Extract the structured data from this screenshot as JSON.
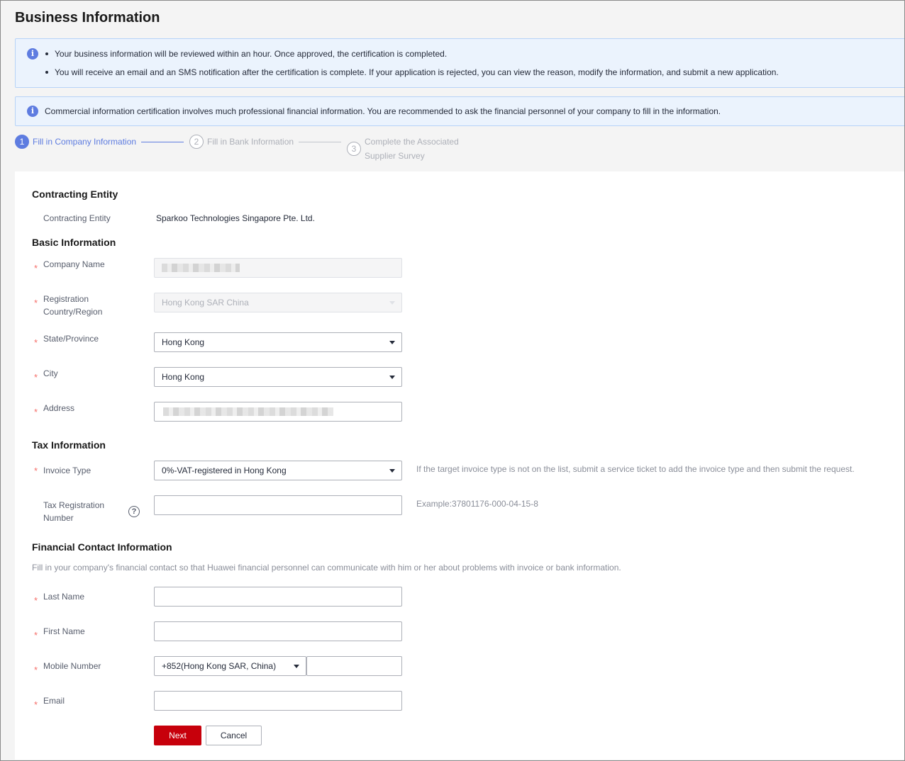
{
  "page": {
    "title": "Business Information"
  },
  "notices": {
    "review": [
      "Your business information will be reviewed within an hour. Once approved, the certification is completed.",
      "You will receive an email and an SMS notification after the certification is complete. If your application is rejected, you can view the reason, modify the information, and submit a new application."
    ],
    "finance": "Commercial information certification involves much professional financial information. You are recommended to ask the financial personnel of your company to fill in the information."
  },
  "steps": [
    {
      "number": "1",
      "label": "Fill in Company Information"
    },
    {
      "number": "2",
      "label": "Fill in Bank Information"
    },
    {
      "number": "3",
      "label_line1": "Complete the Associated",
      "label_line2": "Supplier Survey"
    }
  ],
  "contracting": {
    "title": "Contracting Entity",
    "label": "Contracting Entity",
    "value": "Sparkoo Technologies Singapore Pte. Ltd."
  },
  "basic": {
    "title": "Basic Information",
    "company_name_label": "Company Name",
    "country_label_line1": "Registration",
    "country_label_line2": "Country/Region",
    "country_value": "Hong Kong SAR China",
    "state_label": "State/Province",
    "state_value": "Hong Kong",
    "city_label": "City",
    "city_value": "Hong Kong",
    "address_label": "Address"
  },
  "tax": {
    "title": "Tax Information",
    "invoice_label": "Invoice Type",
    "invoice_value": "0%-VAT-registered in Hong Kong",
    "invoice_hint": "If the target invoice type is not on the list, submit a service ticket to add the invoice type and then submit the request.",
    "reg_label_line1": "Tax Registration",
    "reg_label_line2": "Number",
    "reg_hint": "Example:37801176-000-04-15-8",
    "help_glyph": "?"
  },
  "financial": {
    "title": "Financial Contact Information",
    "description": "Fill in your company's financial contact so that Huawei financial personnel can communicate with him or her about problems with invoice or bank information.",
    "last_name_label": "Last Name",
    "first_name_label": "First Name",
    "mobile_label": "Mobile Number",
    "country_code": "+852(Hong Kong SAR, China)",
    "email_label": "Email"
  },
  "actions": {
    "next": "Next",
    "cancel": "Cancel"
  },
  "required_mark": "*",
  "icons": {
    "info": "info-icon",
    "help": "question-circle-icon",
    "dropdown": "caret-down-icon"
  }
}
